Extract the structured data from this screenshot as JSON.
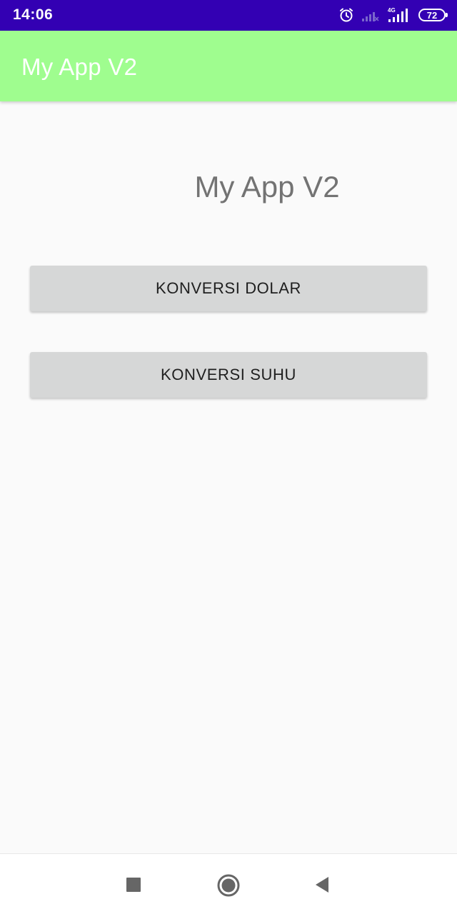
{
  "status_bar": {
    "time": "14:06",
    "battery_level": "72",
    "network_label": "4G",
    "icons": [
      "alarm-icon",
      "signal-weak-icon",
      "signal-4g-icon",
      "battery-icon"
    ],
    "background_color": "#3300b3"
  },
  "app_bar": {
    "title": "My App V2",
    "background_color": "#9ffd8f"
  },
  "main": {
    "heading": "My App V2",
    "buttons": [
      {
        "label": "KONVERSI DOLAR"
      },
      {
        "label": "KONVERSI SUHU"
      }
    ]
  },
  "nav_bar": {
    "icons": [
      "recents-square-icon",
      "home-circle-icon",
      "back-triangle-icon"
    ]
  }
}
